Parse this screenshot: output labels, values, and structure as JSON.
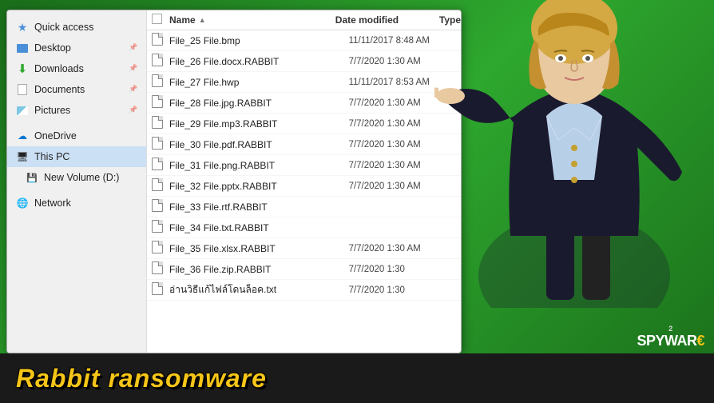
{
  "background_color": "#2a8a2a",
  "bottom_bar": {
    "title": "Rabbit ransomware",
    "watermark_line1": "2SPYWARE",
    "watermark_symbol": "€"
  },
  "explorer": {
    "columns": {
      "name_label": "Name",
      "date_label": "Date modified",
      "type_label": "Type"
    },
    "sidebar": {
      "items": [
        {
          "id": "quick-access",
          "label": "Quick access",
          "icon": "star"
        },
        {
          "id": "desktop",
          "label": "Desktop",
          "icon": "desktop",
          "pinned": true
        },
        {
          "id": "downloads",
          "label": "Downloads",
          "icon": "download",
          "pinned": true,
          "selected": false
        },
        {
          "id": "documents",
          "label": "Documents",
          "icon": "docs",
          "pinned": true
        },
        {
          "id": "pictures",
          "label": "Pictures",
          "icon": "pictures",
          "pinned": true
        },
        {
          "id": "onedrive",
          "label": "OneDrive",
          "icon": "onedrive"
        },
        {
          "id": "thispc",
          "label": "This PC",
          "icon": "thispc",
          "selected": true
        },
        {
          "id": "newvolume",
          "label": "New Volume (D:)",
          "icon": "volume"
        },
        {
          "id": "network",
          "label": "Network",
          "icon": "network"
        }
      ]
    },
    "files": [
      {
        "name": "File_25 File.bmp",
        "date": "11/11/2017 8:48 AM",
        "type": ""
      },
      {
        "name": "File_26 File.docx.RABBIT",
        "date": "7/7/2020 1:30 AM",
        "type": ""
      },
      {
        "name": "File_27 File.hwp",
        "date": "11/11/2017 8:53 AM",
        "type": ""
      },
      {
        "name": "File_28 File.jpg.RABBIT",
        "date": "7/7/2020 1:30 AM",
        "type": ""
      },
      {
        "name": "File_29 File.mp3.RABBIT",
        "date": "7/7/2020 1:30 AM",
        "type": ""
      },
      {
        "name": "File_30 File.pdf.RABBIT",
        "date": "7/7/2020 1:30 AM",
        "type": ""
      },
      {
        "name": "File_31 File.png.RABBIT",
        "date": "7/7/2020 1:30 AM",
        "type": ""
      },
      {
        "name": "File_32 File.pptx.RABBIT",
        "date": "7/7/2020 1:30 AM",
        "type": ""
      },
      {
        "name": "File_33 File.rtf.RABBIT",
        "date": "",
        "type": ""
      },
      {
        "name": "File_34 File.txt.RABBIT",
        "date": "",
        "type": ""
      },
      {
        "name": "File_35 File.xlsx.RABBIT",
        "date": "7/7/2020 1:30 AM",
        "type": ""
      },
      {
        "name": "File_36 File.zip.RABBIT",
        "date": "7/7/2020 1:30",
        "type": ""
      },
      {
        "name": "อ่านวิธีแก้ไฟล์โดนล็อค.txt",
        "date": "7/7/2020 1:30",
        "type": ""
      }
    ]
  }
}
